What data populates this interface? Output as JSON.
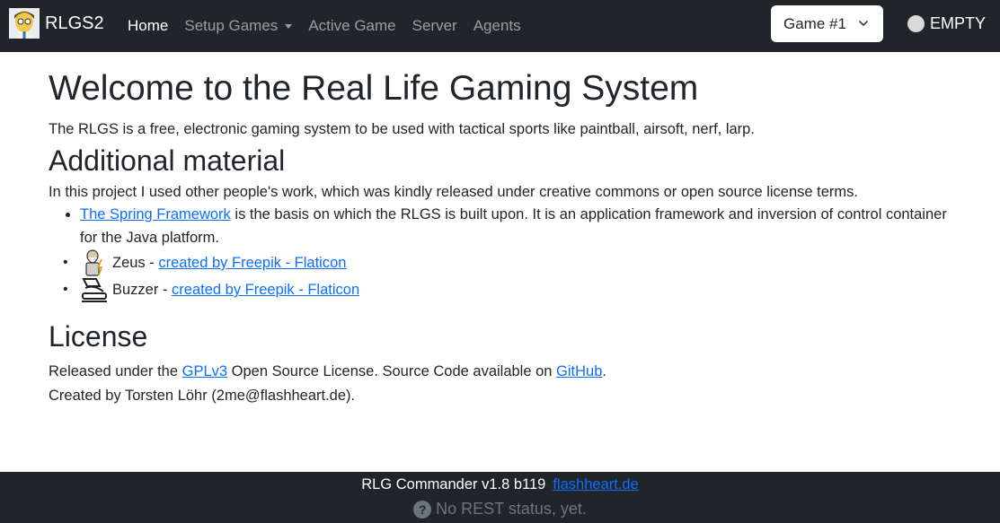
{
  "navbar": {
    "brand": "RLGS2",
    "links": [
      {
        "label": "Home",
        "active": true
      },
      {
        "label": "Setup Games",
        "dropdown": true
      },
      {
        "label": "Active Game"
      },
      {
        "label": "Server"
      },
      {
        "label": "Agents"
      }
    ],
    "game_select": "Game #1",
    "status": "EMPTY"
  },
  "main": {
    "title": "Welcome to the Real Life Gaming System",
    "intro": "The RLGS is a free, electronic gaming system to be used with tactical sports like paintball, airsoft, nerf, larp.",
    "additional_heading": "Additional material",
    "additional_intro": "In this project I used other people's work, which was kindly released under creative commons or open source license terms.",
    "items": [
      {
        "link": "The Spring Framework",
        "text": " is the basis on which the RLGS is built upon. It is an application framework and inversion of control container for the Java platform."
      },
      {
        "icon": "zeus-icon",
        "name": "Zeus - ",
        "link": "created by Freepik - Flaticon"
      },
      {
        "icon": "buzzer-icon",
        "name": "Buzzer - ",
        "link": "created by Freepik - Flaticon"
      }
    ],
    "license_heading": "License",
    "license": {
      "pre": "Released under the ",
      "gpl_link": "GPLv3",
      "mid": " Open Source License. Source Code available on ",
      "github_link": "GitHub",
      "post": "."
    },
    "created_by": "Created by Torsten Löhr (2me@flashheart.de)."
  },
  "footer": {
    "version": "RLG Commander v1.8 b119",
    "link": "flashheart.de",
    "rest_status": "No REST status, yet."
  },
  "colors": {
    "navbar_bg": "#212529",
    "link": "#0d6efd",
    "muted": "#6c757d"
  }
}
